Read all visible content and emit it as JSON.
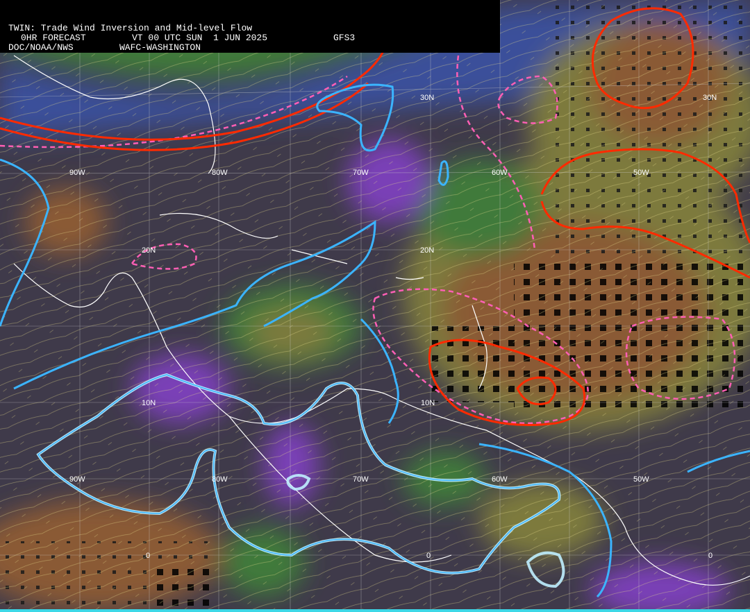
{
  "header": {
    "title": "TWIN: Trade Wind Inversion and Mid-level Flow",
    "forecast": "0HR FORECAST",
    "valid_time": "VT 00 UTC SUN  1 JUN 2025",
    "model": "GFS3",
    "agency": "DOC/NOAA/NWS",
    "center": "WAFC-WASHINGTON"
  },
  "colors": {
    "background": "#3f3a4a",
    "purple": "#7a3fb7",
    "blue": "#3b4f9a",
    "green": "#3f7a3a",
    "olive": "#7d7a3c",
    "brown": "#8a5a34",
    "streamlines": "#e7dc8a",
    "coast": "#ffffff",
    "cyan_contour": "#3bb4ff",
    "red_contour": "#ff2a00",
    "pink_dash": "#ff5fb5",
    "footer": "#3cd7e6"
  },
  "map_labels": {
    "lat": [
      "30N",
      "30N",
      "20N",
      "20N",
      "10N",
      "10N",
      "0",
      "0",
      "0"
    ],
    "lon": [
      "90W",
      "80W",
      "70W",
      "60W",
      "50W",
      "90W",
      "80W",
      "70W",
      "60W",
      "50W"
    ]
  }
}
